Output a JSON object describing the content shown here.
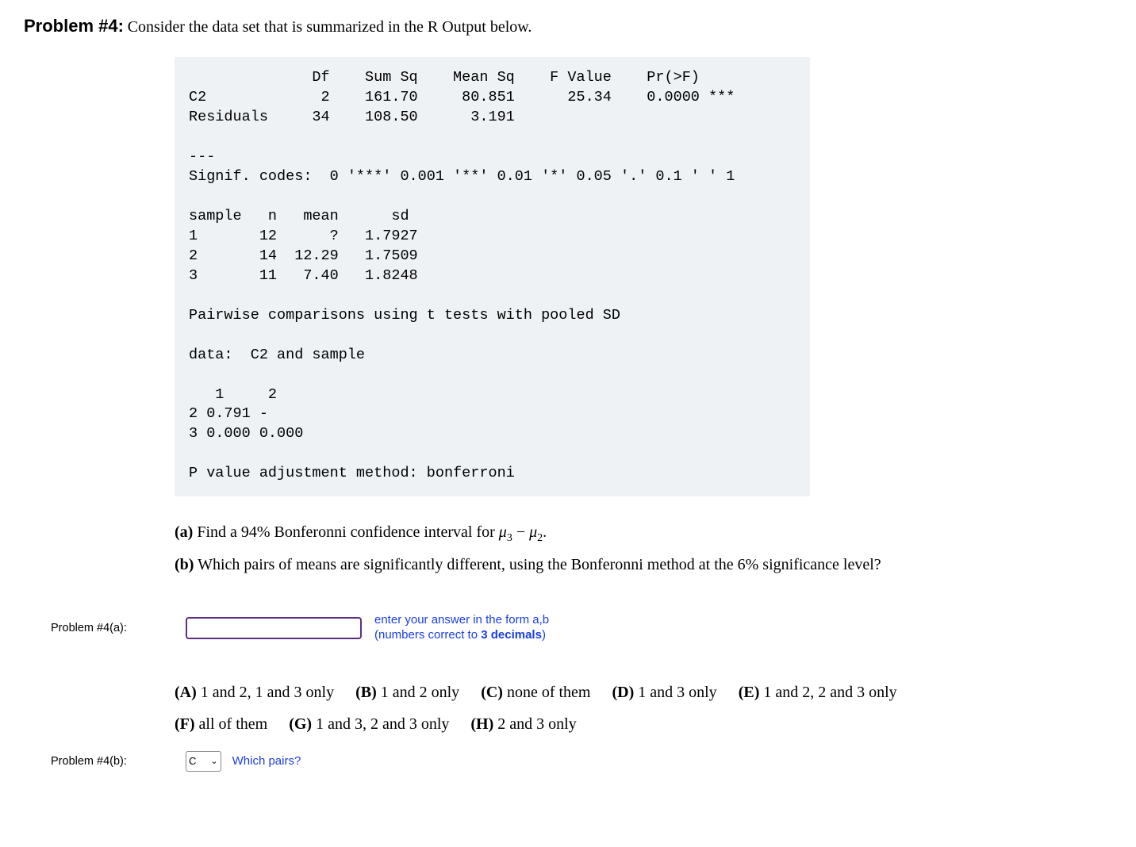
{
  "problem": {
    "label": "Problem #4:",
    "prompt": "Consider the data set that is summarized in the R Output below."
  },
  "r_output": {
    "anova_header": "              Df    Sum Sq    Mean Sq    F Value    Pr(>F)",
    "anova_row1": "C2             2    161.70     80.851      25.34    0.0000 ***",
    "anova_row2": "Residuals     34    108.50      3.191",
    "sep": "---",
    "signif": "Signif. codes:  0 '***' 0.001 '**' 0.01 '*' 0.05 '.' 0.1 ' ' 1",
    "sample_header": "sample   n   mean      sd",
    "sample_row1": "1       12      ?   1.7927",
    "sample_row2": "2       14  12.29   1.7509",
    "sample_row3": "3       11   7.40   1.8248",
    "pairwise": "Pairwise comparisons using t tests with pooled SD",
    "data_line": "data:  C2 and sample",
    "pw_header": "   1     2",
    "pw_row2": "2 0.791 -",
    "pw_row3": "3 0.000 0.000",
    "adjust": "P value adjustment method: bonferroni"
  },
  "questions": {
    "a_label": "(a)",
    "a_text_1": "Find a 94% Bonferonni confidence interval for ",
    "a_mu_expr_1": "μ",
    "a_mu_sub_1": "3",
    "a_minus": " − ",
    "a_mu_expr_2": "μ",
    "a_mu_sub_2": "2",
    "a_period": ".",
    "b_label": "(b)",
    "b_text": "Which pairs of means are significantly different, using the Bonferonni method at the 6% significance level?"
  },
  "answers": {
    "a_label": "Problem #4(a):",
    "a_input_value": "",
    "a_hint_line1": "enter your answer in the form a,b",
    "a_hint_line2_pre": "(numbers correct to ",
    "a_hint_line2_bold": "3 decimals",
    "a_hint_line2_post": ")",
    "b_label": "Problem #4(b):",
    "b_select_value": "C",
    "b_which": "Which pairs?"
  },
  "mc": {
    "A": {
      "letter": "(A)",
      "text": "1 and 2, 1 and 3 only"
    },
    "B": {
      "letter": "(B)",
      "text": "1 and 2 only"
    },
    "C": {
      "letter": "(C)",
      "text": "none of them"
    },
    "D": {
      "letter": "(D)",
      "text": "1 and 3 only"
    },
    "E": {
      "letter": "(E)",
      "text": "1 and 2, 2 and 3 only"
    },
    "F": {
      "letter": "(F)",
      "text": "all of them"
    },
    "G": {
      "letter": "(G)",
      "text": "1 and 3, 2 and 3 only"
    },
    "H": {
      "letter": "(H)",
      "text": "2 and 3 only"
    }
  }
}
